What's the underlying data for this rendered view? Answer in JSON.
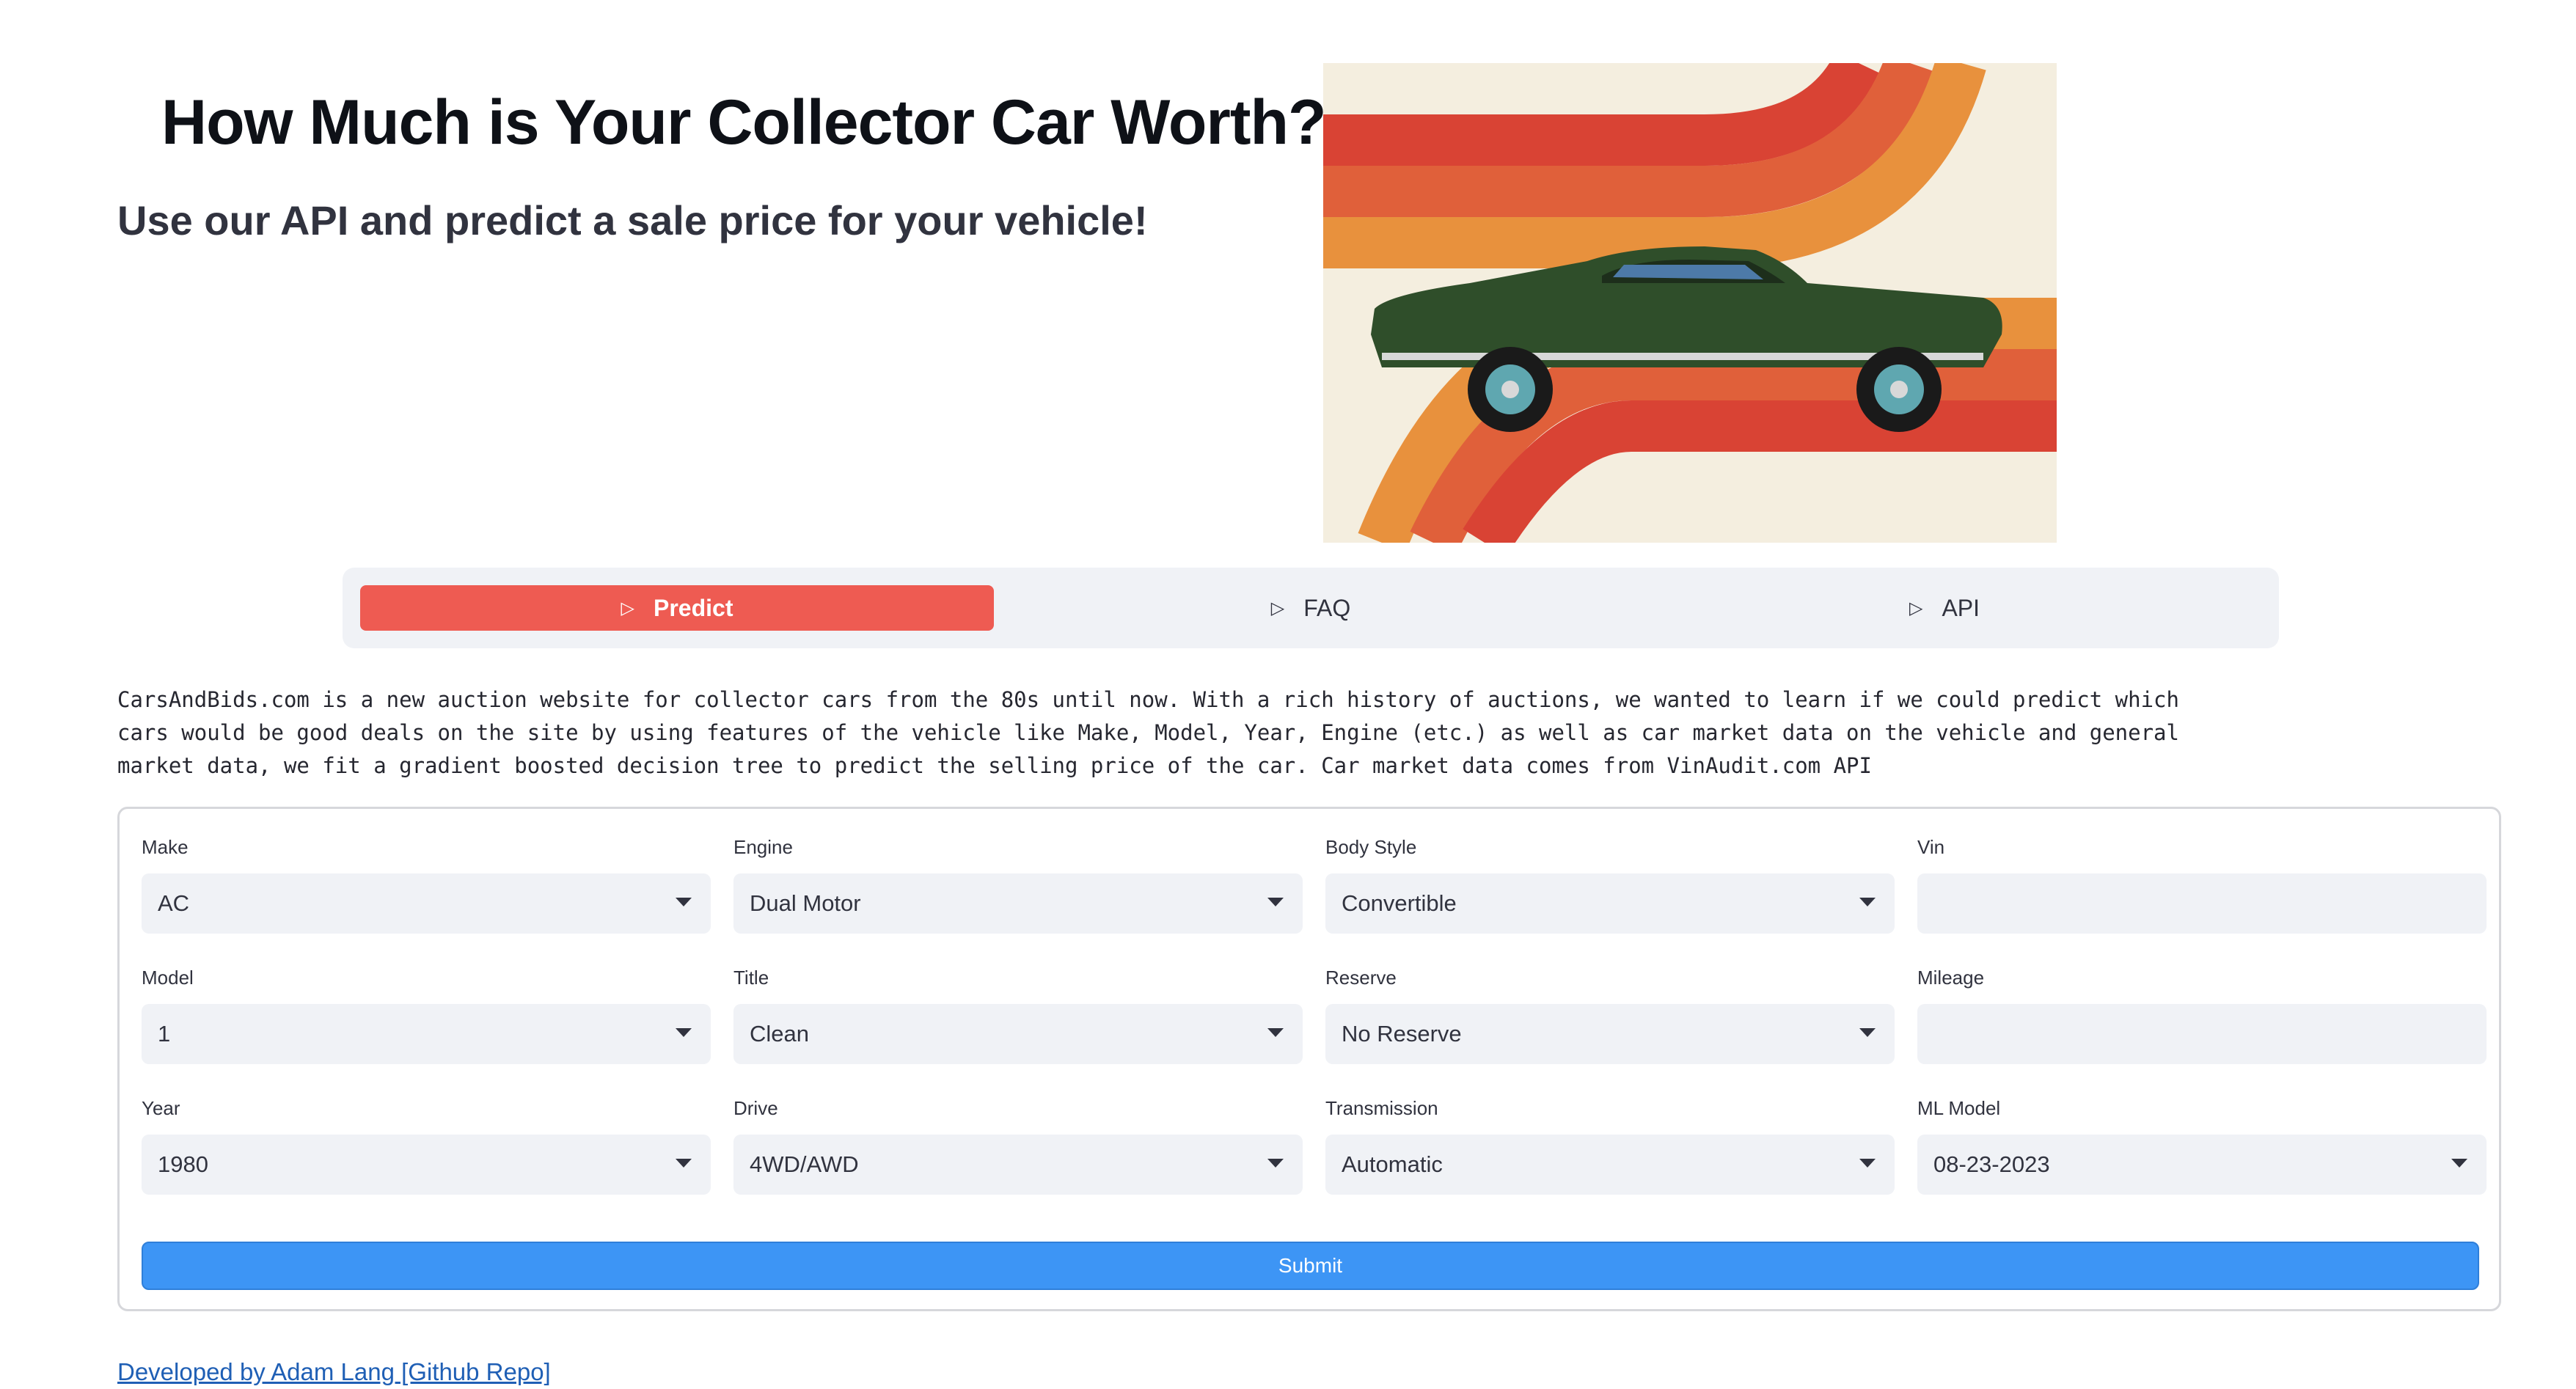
{
  "header": {
    "title": "How Much is Your Collector Car Worth?",
    "subtitle": "Use our API and predict a sale price for your vehicle!"
  },
  "tabs": [
    {
      "label": "Predict",
      "active": true,
      "icon": "play-outline-icon"
    },
    {
      "label": "FAQ",
      "active": false,
      "icon": "play-outline-icon"
    },
    {
      "label": "API",
      "active": false,
      "icon": "play-outline-icon"
    }
  ],
  "description": "CarsAndBids.com is a new auction website for collector cars from the 80s until now. With a rich history of auctions, we wanted to learn if we could predict which cars would be good deals on the site by using features of the vehicle like Make, Model, Year, Engine (etc.) as well as car market data on the vehicle and general market data, we fit a gradient boosted decision tree to predict the selling price of the car. Car market data comes from VinAudit.com API",
  "form": {
    "make": {
      "label": "Make",
      "value": "AC"
    },
    "engine": {
      "label": "Engine",
      "value": "Dual Motor"
    },
    "body_style": {
      "label": "Body Style",
      "value": "Convertible"
    },
    "vin": {
      "label": "Vin",
      "value": ""
    },
    "model": {
      "label": "Model",
      "value": "1"
    },
    "title": {
      "label": "Title",
      "value": "Clean"
    },
    "reserve": {
      "label": "Reserve",
      "value": "No Reserve"
    },
    "mileage": {
      "label": "Mileage",
      "value": ""
    },
    "year": {
      "label": "Year",
      "value": "1980"
    },
    "drive": {
      "label": "Drive",
      "value": "4WD/AWD"
    },
    "transmission": {
      "label": "Transmission",
      "value": "Automatic"
    },
    "ml_model": {
      "label": "ML Model",
      "value": "08-23-2023"
    },
    "submit_label": "Submit"
  },
  "footer": {
    "link_text": "Developed by Adam Lang [Github Repo]"
  },
  "colors": {
    "accent_tab": "#ee5b52",
    "submit": "#3d95f5",
    "link": "#1f5fb5",
    "input_bg": "#f0f2f6"
  }
}
